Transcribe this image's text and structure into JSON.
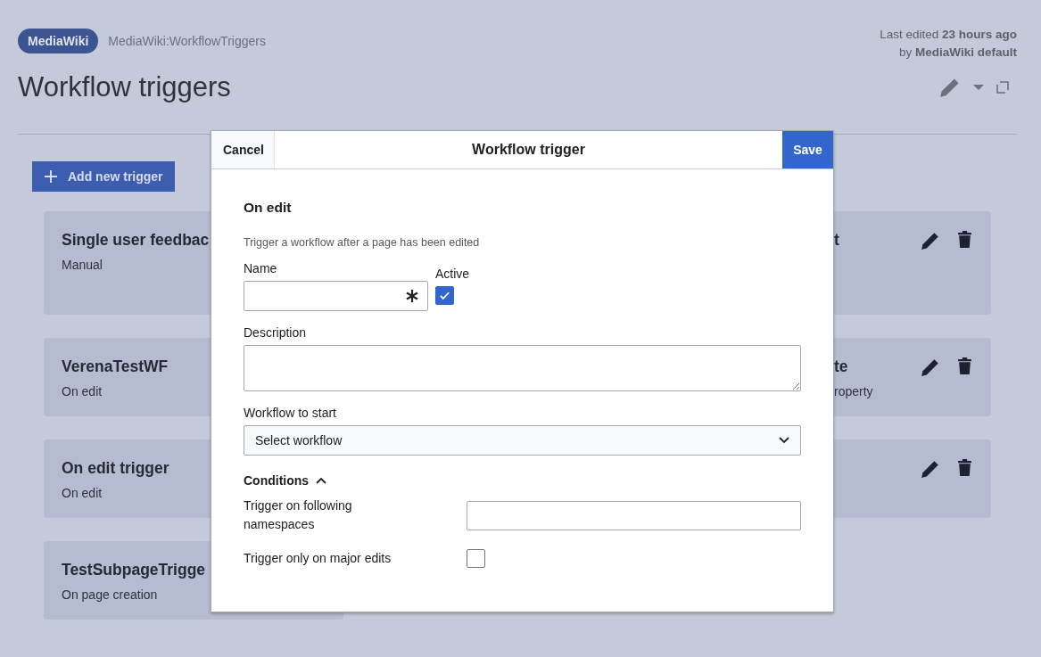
{
  "header": {
    "badge": "MediaWiki",
    "breadcrumb": "MediaWiki:WorkflowTriggers",
    "last_edited": "Last edited **23 hours ago**",
    "edited_by": "by **MediaWiki default**"
  },
  "title": "Workflow triggers",
  "add_button": "Add new trigger",
  "card_rows": [
    {
      "tall": true,
      "cards": [
        {
          "kind": "left",
          "title": "Single user feedbac",
          "subtitle": "Manual"
        },
        {
          "kind": "right",
          "title": "t"
        }
      ]
    },
    {
      "tall": false,
      "cards": [
        {
          "kind": "left",
          "title": "VerenaTestWF",
          "subtitle": "On edit"
        },
        {
          "kind": "right",
          "title": "te",
          "subtitle": "roperty"
        }
      ]
    },
    {
      "tall": false,
      "cards": [
        {
          "kind": "left",
          "title": "On edit trigger",
          "subtitle": "On edit"
        },
        {
          "kind": "right"
        }
      ]
    },
    {
      "tall": false,
      "cards": [
        {
          "kind": "left",
          "title": "TestSubpageTrigge",
          "subtitle": "On page creation"
        }
      ]
    }
  ],
  "dialog": {
    "cancel": "Cancel",
    "title": "Workflow trigger",
    "save": "Save",
    "section": "On edit",
    "help": "Trigger a workflow after a page has been edited",
    "name": {
      "label": "Name",
      "required": true
    },
    "active": {
      "label": "Active",
      "checked": true
    },
    "description": {
      "label": "Description"
    },
    "workflow": {
      "label": "Workflow to start",
      "value": "Select workflow"
    },
    "conditions": {
      "label": "Conditions",
      "expanded": true,
      "fields": [
        {
          "kind": "text",
          "label": "Trigger on following namespaces"
        },
        {
          "kind": "checkbox",
          "label": "Trigger only on major edits",
          "checked": false
        }
      ]
    }
  }
}
